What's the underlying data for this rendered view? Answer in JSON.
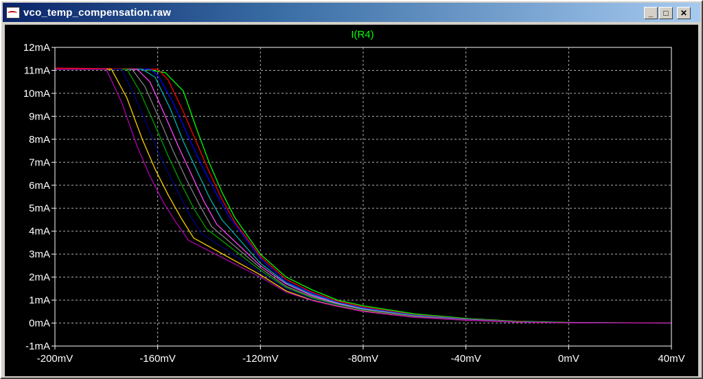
{
  "window": {
    "title": "vco_temp_compensation.raw",
    "controls": {
      "minimize": "_",
      "maximize": "□",
      "close": "✕"
    }
  },
  "colors": {
    "background": "#000000",
    "axes": "#ffffff",
    "grid": "#b0b0b0",
    "title": "#00ff00"
  },
  "chart_data": {
    "type": "line",
    "title": "I(R4)",
    "xlabel": "",
    "ylabel": "",
    "xlim": [
      -200,
      40
    ],
    "ylim": [
      -1,
      12
    ],
    "x_unit": "mV",
    "y_unit": "mA",
    "grid": true,
    "x_ticks": [
      "-200mV",
      "-160mV",
      "-120mV",
      "-80mV",
      "-40mV",
      "0mV",
      "40mV"
    ],
    "y_ticks": [
      "-1mA",
      "0mA",
      "1mA",
      "2mA",
      "3mA",
      "4mA",
      "5mA",
      "6mA",
      "7mA",
      "8mA",
      "9mA",
      "10mA",
      "11mA",
      "12mA"
    ],
    "series": [
      {
        "color": "#00ff00",
        "x": [
          -200,
          -165,
          -157,
          -150,
          -145,
          -140,
          -135,
          -130,
          -120,
          -110,
          -100,
          -90,
          -80,
          -60,
          -40,
          -20,
          0,
          40
        ],
        "y": [
          11.05,
          11.05,
          10.9,
          10.1,
          8.5,
          7.0,
          5.7,
          4.6,
          3.0,
          2.0,
          1.45,
          1.0,
          0.75,
          0.4,
          0.2,
          0.08,
          0.03,
          0
        ]
      },
      {
        "color": "#ff0000",
        "x": [
          -200,
          -160,
          -156,
          -150,
          -145,
          -140,
          -135,
          -130,
          -120,
          -110,
          -100,
          -90,
          -80,
          -60,
          -40,
          -20,
          0,
          40
        ],
        "y": [
          11.1,
          11.05,
          10.6,
          9.2,
          7.9,
          6.6,
          5.4,
          4.4,
          2.9,
          1.9,
          1.35,
          0.95,
          0.7,
          0.36,
          0.18,
          0.07,
          0.02,
          0
        ]
      },
      {
        "color": "#0000ff",
        "x": [
          -200,
          -163,
          -160,
          -154,
          -148,
          -143,
          -137,
          -132,
          -120,
          -110,
          -100,
          -90,
          -80,
          -60,
          -40,
          -20,
          0,
          40
        ],
        "y": [
          11.05,
          11.05,
          10.8,
          9.6,
          8.1,
          6.9,
          5.6,
          4.6,
          2.8,
          1.8,
          1.3,
          0.9,
          0.66,
          0.34,
          0.17,
          0.06,
          0.02,
          0
        ]
      },
      {
        "color": "#00b0b0",
        "x": [
          -200,
          -166,
          -161,
          -155,
          -150,
          -145,
          -140,
          -135,
          -120,
          -110,
          -100,
          -90,
          -80,
          -60,
          -40,
          -20,
          0,
          40
        ],
        "y": [
          11.05,
          11.05,
          10.7,
          9.3,
          7.9,
          6.7,
          5.5,
          4.5,
          2.6,
          1.75,
          1.25,
          0.88,
          0.63,
          0.32,
          0.16,
          0.06,
          0.02,
          0
        ]
      },
      {
        "color": "#ff44ff",
        "x": [
          -200,
          -168,
          -163,
          -157,
          -152,
          -147,
          -142,
          -137,
          -120,
          -110,
          -100,
          -90,
          -80,
          -60,
          -40,
          -20,
          0,
          40
        ],
        "y": [
          11.05,
          11.05,
          10.5,
          9.0,
          7.7,
          6.5,
          5.3,
          4.3,
          2.5,
          1.7,
          1.2,
          0.85,
          0.6,
          0.3,
          0.15,
          0.05,
          0.02,
          0
        ]
      },
      {
        "color": "#808080",
        "x": [
          -200,
          -170,
          -165,
          -159,
          -154,
          -149,
          -144,
          -139,
          -120,
          -110,
          -100,
          -90,
          -80,
          -60,
          -40,
          -20,
          0,
          40
        ],
        "y": [
          11.05,
          11.05,
          10.3,
          8.8,
          7.5,
          6.3,
          5.2,
          4.2,
          2.4,
          1.6,
          1.15,
          0.82,
          0.58,
          0.29,
          0.14,
          0.05,
          0.02,
          0
        ]
      },
      {
        "color": "#00a000",
        "x": [
          -200,
          -172,
          -167,
          -161,
          -156,
          -151,
          -146,
          -141,
          -120,
          -110,
          -100,
          -90,
          -80,
          -60,
          -40,
          -20,
          0,
          40
        ],
        "y": [
          11.05,
          11.05,
          10.1,
          8.6,
          7.3,
          6.1,
          5.0,
          4.1,
          2.3,
          1.55,
          1.1,
          0.8,
          0.56,
          0.28,
          0.13,
          0.05,
          0.01,
          0
        ]
      },
      {
        "color": "#00007f",
        "x": [
          -200,
          -174,
          -169,
          -163,
          -158,
          -153,
          -148,
          -143,
          -120,
          -110,
          -100,
          -90,
          -80,
          -60,
          -40,
          -20,
          0,
          40
        ],
        "y": [
          11.05,
          11.05,
          9.9,
          8.3,
          7.0,
          5.9,
          4.8,
          3.9,
          2.2,
          1.5,
          1.05,
          0.77,
          0.54,
          0.27,
          0.13,
          0.04,
          0.01,
          0
        ]
      },
      {
        "color": "#ffd000",
        "x": [
          -200,
          -178,
          -172,
          -166,
          -161,
          -156,
          -151,
          -146,
          -120,
          -110,
          -100,
          -90,
          -80,
          -60,
          -40,
          -20,
          0,
          40
        ],
        "y": [
          11.05,
          11.05,
          9.8,
          8.0,
          6.7,
          5.6,
          4.6,
          3.7,
          2.1,
          1.4,
          1.0,
          0.74,
          0.52,
          0.26,
          0.12,
          0.04,
          0.01,
          0
        ]
      },
      {
        "color": "#b000b0",
        "x": [
          -200,
          -180,
          -174,
          -168,
          -163,
          -158,
          -153,
          -148,
          -120,
          -110,
          -100,
          -90,
          -80,
          -60,
          -40,
          -20,
          0,
          40
        ],
        "y": [
          11.05,
          11.05,
          9.6,
          7.7,
          6.4,
          5.3,
          4.4,
          3.6,
          2.0,
          1.35,
          0.98,
          0.72,
          0.5,
          0.25,
          0.12,
          0.04,
          0.01,
          0
        ]
      }
    ]
  }
}
